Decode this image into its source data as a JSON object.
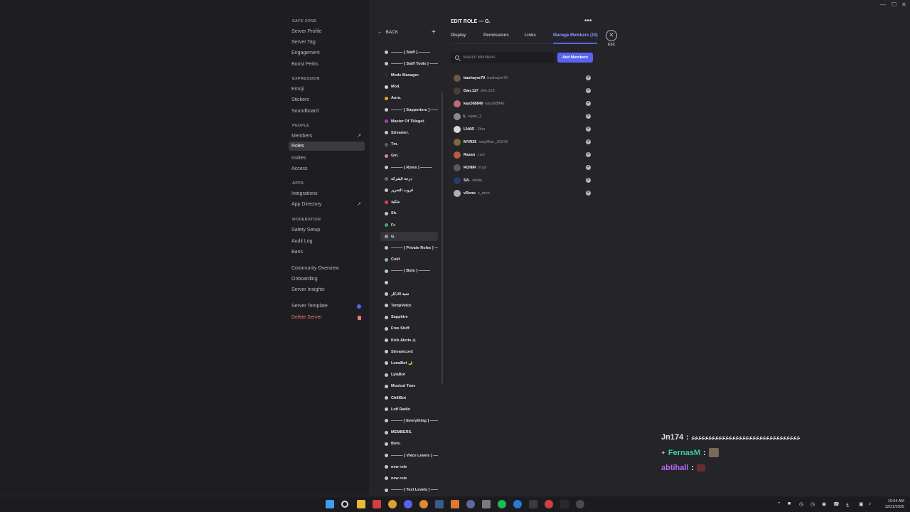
{
  "window": {
    "minimize": "—",
    "maximize": "☐",
    "close": "✕"
  },
  "sidebar": {
    "sections": [
      {
        "title": "SAFE ZONE",
        "items": [
          {
            "label": "Server Profile"
          },
          {
            "label": "Server Tag"
          },
          {
            "label": "Engagement"
          },
          {
            "label": "Boost Perks"
          }
        ]
      },
      {
        "title": "EXPRESSION",
        "items": [
          {
            "label": "Emoji"
          },
          {
            "label": "Stickers"
          },
          {
            "label": "Soundboard"
          }
        ]
      },
      {
        "title": "PEOPLE",
        "items": [
          {
            "label": "Members"
          },
          {
            "label": "Roles",
            "active": true
          },
          {
            "label": "Invites"
          },
          {
            "label": "Access"
          }
        ]
      },
      {
        "title": "APPS",
        "items": [
          {
            "label": "Integrations"
          },
          {
            "label": "App Directory"
          }
        ]
      },
      {
        "title": "MODERATION",
        "items": [
          {
            "label": "Safety Setup"
          },
          {
            "label": "Audit Log"
          },
          {
            "label": "Bans"
          }
        ]
      },
      {
        "title": "",
        "items": [
          {
            "label": "Community Overview"
          },
          {
            "label": "Onboarding"
          },
          {
            "label": "Server Insights"
          }
        ]
      },
      {
        "title": "",
        "items": [
          {
            "label": "Server Template"
          },
          {
            "label": "Delete Server"
          }
        ]
      }
    ]
  },
  "roles_panel": {
    "back_label": "BACK",
    "add_icon": "+",
    "roles": [
      {
        "name": "——— [ Staff ] ———",
        "color": "#c8c8cc"
      },
      {
        "name": "——— [ Staff Tools ] ———",
        "color": "#c8c8cc"
      },
      {
        "name": "Mods Manager.",
        "color": "#2a2a30"
      },
      {
        "name": "Mod.",
        "color": "#d5d5d9"
      },
      {
        "name": "Aura.",
        "color": "#e8a53a"
      },
      {
        "name": "——— [ Supporters ] ———",
        "color": "#c8c8cc"
      },
      {
        "name": "Master Of Tkleget.",
        "color": "#b53aa8"
      },
      {
        "name": "Streamer.",
        "color": "#c8c8cc"
      },
      {
        "name": "Tm.",
        "color": "#5c5d64"
      },
      {
        "name": "Gm.",
        "color": "#d88aa0"
      },
      {
        "name": "——— [ Roles ] ———",
        "color": "#c8c8cc"
      },
      {
        "name": "درجة الشركة",
        "color": "#6b6c72"
      },
      {
        "name": "قروب التحرير",
        "color": "#c8c8cc"
      },
      {
        "name": "ملكية",
        "color": "#d04848"
      },
      {
        "name": "Sh.",
        "color": "#c8c8cc"
      },
      {
        "name": "Fr.",
        "color": "#3fa86a"
      },
      {
        "name": "G.",
        "color": "#9c9da3"
      },
      {
        "name": "——— [ Private Roles ] ———",
        "color": "#c8c8cc"
      },
      {
        "name": "Cold",
        "color": "#8ab8a8"
      },
      {
        "name": "——— [ Bots ] ———",
        "color": "#c8c8cc"
      },
      {
        "name": "",
        "color": "#c8c8cc"
      },
      {
        "name": "نخبة الأذكار",
        "color": "#c8c8cc"
      },
      {
        "name": "TempVoice",
        "color": "#c8c8cc"
      },
      {
        "name": "Sapphire",
        "color": "#c8c8cc"
      },
      {
        "name": "Free Stuff",
        "color": "#c8c8cc"
      },
      {
        "name": "Kick Alerts ⚠",
        "color": "#c8c8cc"
      },
      {
        "name": "Streamcord",
        "color": "#c8c8cc"
      },
      {
        "name": "LunaBot 🌙",
        "color": "#c8c8cc"
      },
      {
        "name": "LylaBot",
        "color": "#c8c8cc"
      },
      {
        "name": "Musical Tune",
        "color": "#c8c8cc"
      },
      {
        "name": "ChillBot",
        "color": "#c8c8cc"
      },
      {
        "name": "Lofi Radio",
        "color": "#c8c8cc"
      },
      {
        "name": "——— [ Everything ] ———",
        "color": "#c8c8cc"
      },
      {
        "name": "MEMBERS.",
        "color": "#c8c8cc"
      },
      {
        "name": "Bots.",
        "color": "#c8c8cc"
      },
      {
        "name": "——— [ Voice Levels ] ———",
        "color": "#c8c8cc"
      },
      {
        "name": "new role",
        "color": "#c8c8cc"
      },
      {
        "name": "new role",
        "color": "#c8c8cc"
      },
      {
        "name": "——— [ Text Levels ] ———",
        "color": "#c8c8cc"
      }
    ]
  },
  "edit_role": {
    "title": "EDIT ROLE — G.",
    "more_icon": "•••",
    "tabs": [
      {
        "label": "Display"
      },
      {
        "label": "Permissions"
      },
      {
        "label": "Links"
      },
      {
        "label": "Manage Members (10)",
        "active": true
      }
    ],
    "close_icon": "✕",
    "esc_label": "ESC",
    "search": {
      "placeholder": "Search Members",
      "value": ""
    },
    "add_members_label": "Add Members",
    "members": [
      {
        "name": "bashayer70",
        "username": "bashayer70",
        "avatar_color": "#6b5a48"
      },
      {
        "name": "Dan.117",
        "username": "dhn.123",
        "avatar_color": "#4a4030"
      },
      {
        "name": "kay268840",
        "username": "kay268840",
        "avatar_color": "#c06a7a"
      },
      {
        "name": "L",
        "username": "lujain_2",
        "avatar_color": "#8a8b90"
      },
      {
        "name": "LNAR",
        "username": ".2lno",
        "avatar_color": "#d8d8dc"
      },
      {
        "name": "MYR25",
        "username": "may25ar._63243",
        "avatar_color": "#7a6a3a"
      },
      {
        "name": "Razan",
        "username": ".rrzn",
        "avatar_color": "#c05a40"
      },
      {
        "name": "RONIR",
        "username": "truiyr",
        "avatar_color": "#5a5a60"
      },
      {
        "name": "SA.",
        "username": "sillala",
        "avatar_color": "#2a3a6a"
      },
      {
        "name": "vReno",
        "username": "v_reno",
        "avatar_color": "#b0b0b4"
      }
    ],
    "remove_icon": "×"
  },
  "chat_overlay": {
    "lines": [
      {
        "user": "Jn174",
        "sep": ":",
        "text": "ﻋﻋﻋﻋﻋﻋﻋﻋﻋﻋﻋﻋﻋﻋﻋﻋﻋﻋﻋﻋﻋﻋﻋﻋﻋﻋﻋﻋﻋﻋﻋﻋ",
        "color": "#e6e7ea"
      },
      {
        "user": "FernasM",
        "sep": ":",
        "text": "",
        "color": "#3fd0a0"
      },
      {
        "user": "abtihall",
        "sep": ":",
        "text": "",
        "color": "#b867f0"
      }
    ]
  },
  "taskbar": {
    "time": "10:54 AM",
    "date": "12/21/2025",
    "tray_lang": "ع"
  }
}
